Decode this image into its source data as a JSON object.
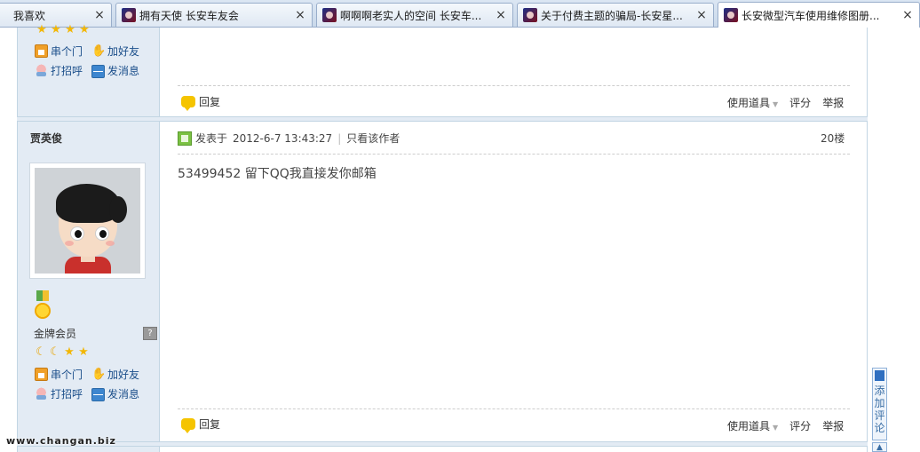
{
  "tabs": [
    {
      "label": "我喜欢",
      "favicon": "changan-logo-icon",
      "active": false
    },
    {
      "label": "拥有天使  长安车友会",
      "favicon": "changan-logo-icon",
      "active": false
    },
    {
      "label": "啊啊啊老实人的空间  长安车...",
      "favicon": "changan-logo-icon",
      "active": false
    },
    {
      "label": "关于付费主题的骗局-长安星...",
      "favicon": "changan-logo-icon",
      "active": false
    },
    {
      "label": "长安微型汽车使用维修图册...",
      "favicon": "changan-logo-icon",
      "active": true
    }
  ],
  "tab_close_glyph": "×",
  "previous_post": {
    "actions": {
      "visit": "串个门",
      "add_friend": "加好友",
      "greet": "打招呼",
      "message": "发消息"
    },
    "reply_label": "回复",
    "tools": {
      "use_tool": "使用道具",
      "rate": "评分",
      "report": "举报"
    }
  },
  "post": {
    "author": "贾英俊",
    "grade": "金牌会员",
    "grade_button": "?",
    "actions": {
      "visit": "串个门",
      "add_friend": "加好友",
      "greet": "打招呼",
      "message": "发消息"
    },
    "posted_prefix": "发表于",
    "posted_time": "2012-6-7 13:43:27",
    "only_author": "只看该作者",
    "floor": "20楼",
    "message": "53499452   留下QQ我直接发你邮箱",
    "reply_label": "回复",
    "tools": {
      "use_tool": "使用道具",
      "rate": "评分",
      "report": "举报"
    }
  },
  "float": {
    "comment_label": "添加评论",
    "top_glyph": "▲"
  },
  "watermark": "www.changan.biz",
  "colors": {
    "sidebar_bg": "#e3ebf4",
    "link": "#1a4e8a",
    "border": "#c2d5e3"
  }
}
